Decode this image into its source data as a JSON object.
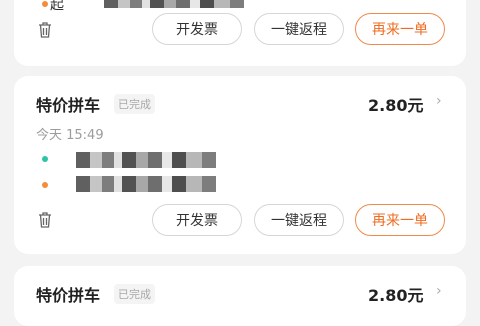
{
  "orders": [
    {
      "address": "起",
      "buttons": {
        "invoice": "开发票",
        "return_trip": "一键返程",
        "reorder": "再来一单"
      }
    },
    {
      "title": "特价拼车",
      "status": "已完成",
      "price": "2.80元",
      "time": "今天 15:49",
      "buttons": {
        "invoice": "开发票",
        "return_trip": "一键返程",
        "reorder": "再来一单"
      }
    },
    {
      "title": "特价拼车",
      "status": "已完成",
      "price": "2.80元"
    }
  ],
  "icons": {
    "trash": "trash-icon",
    "chevron": "chevron-right-icon"
  },
  "colors": {
    "accent": "#ef6c22",
    "background": "#f3f3f3",
    "start_dot": "#2ec4a6",
    "end_dot": "#f58c3a"
  }
}
